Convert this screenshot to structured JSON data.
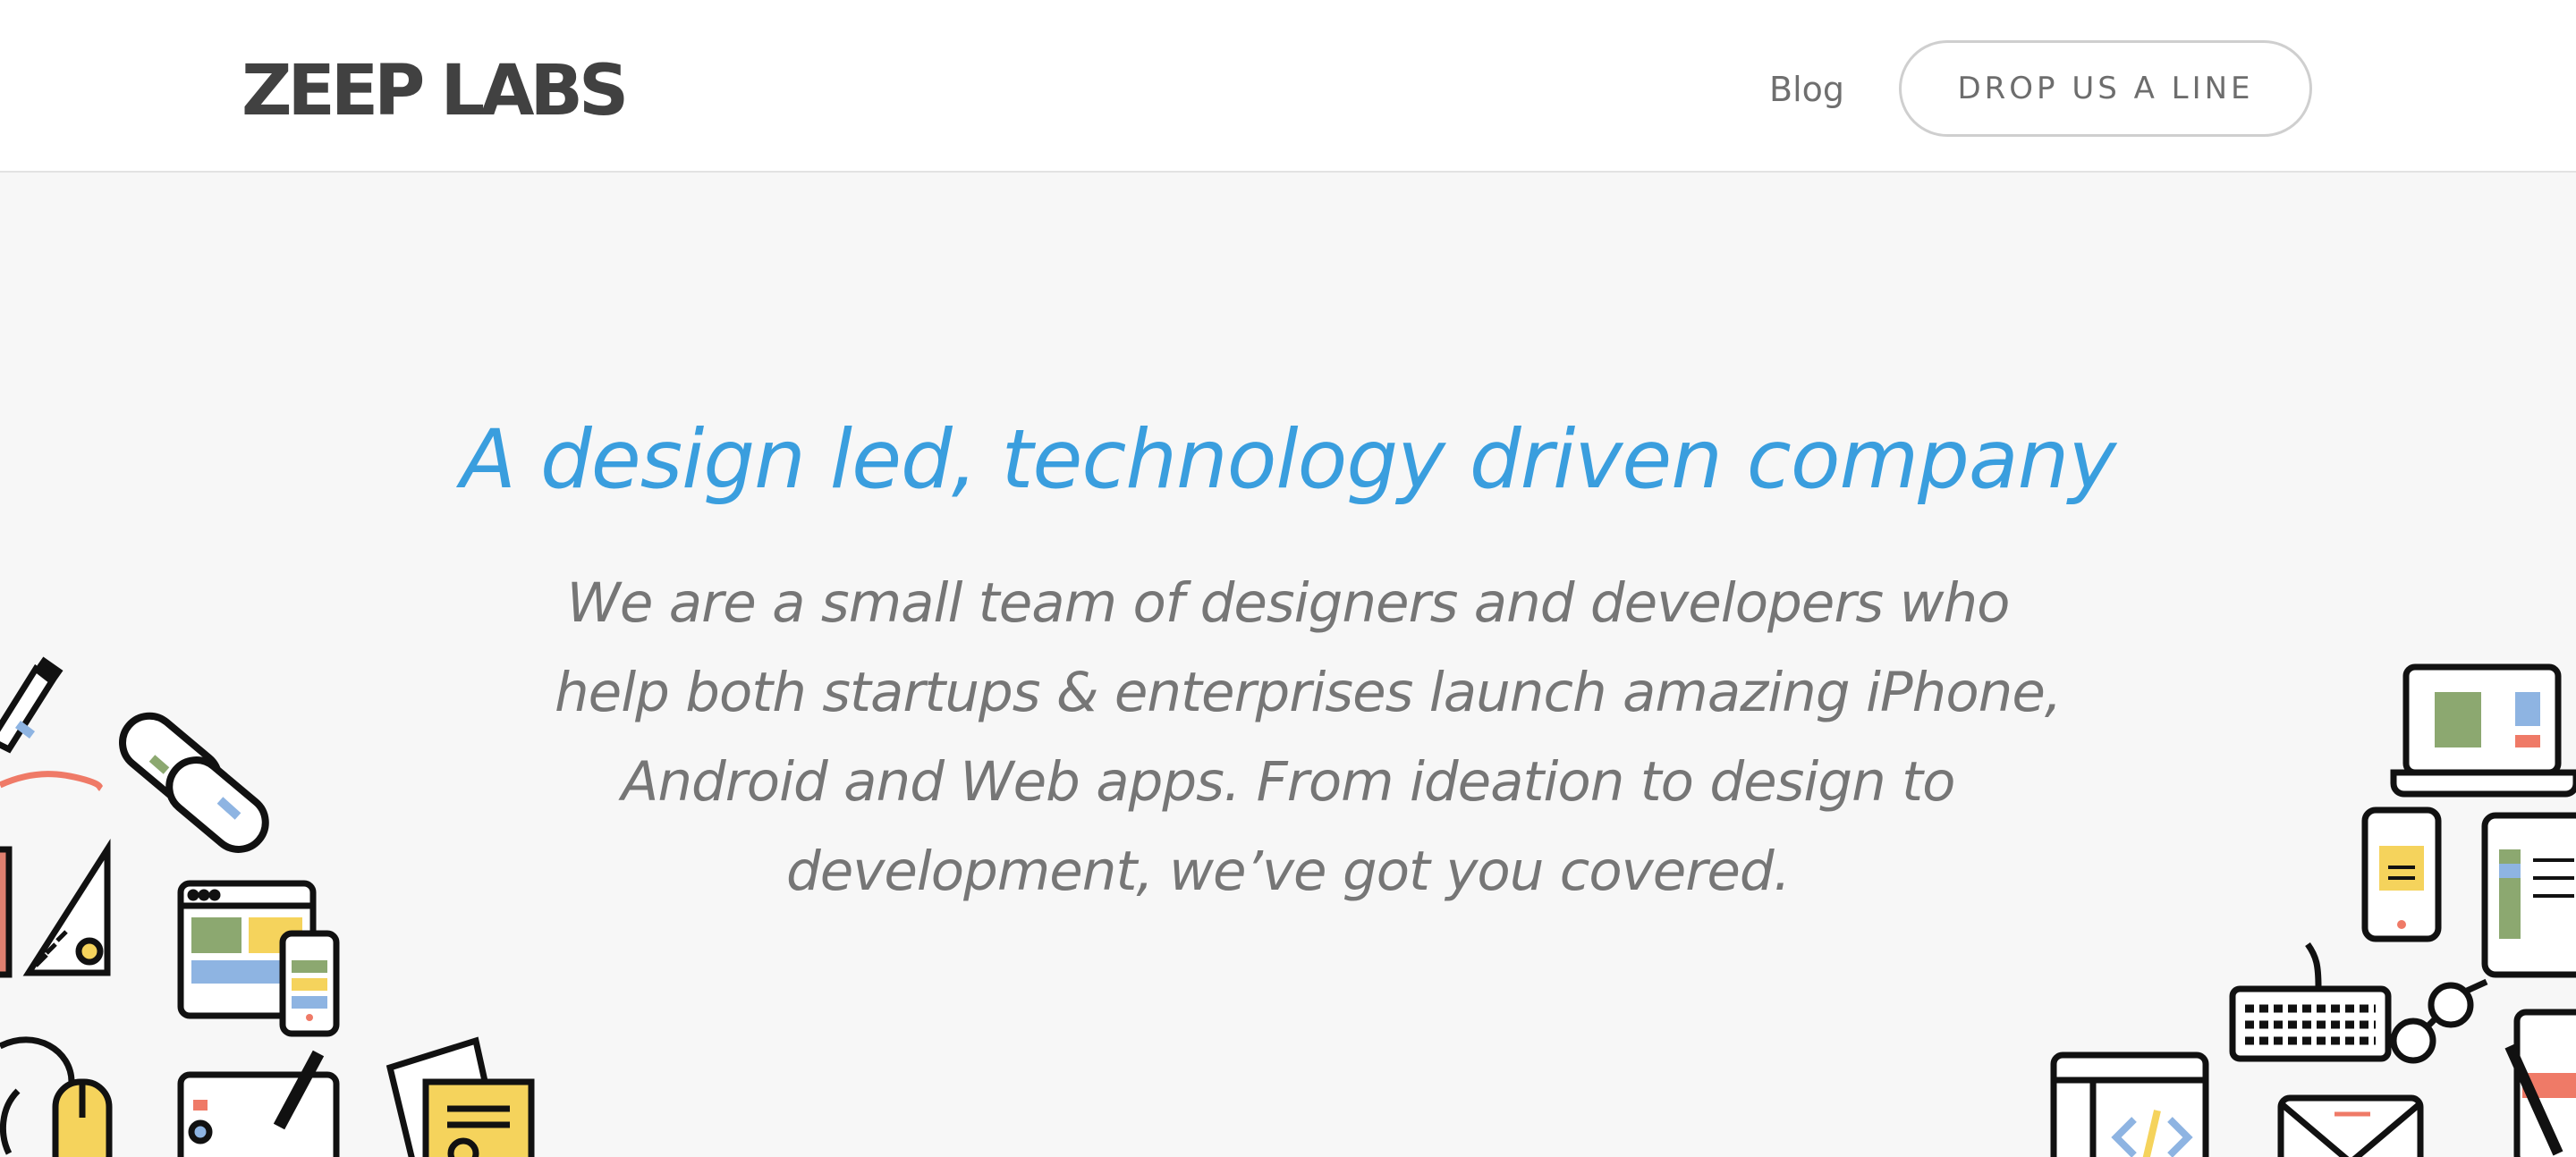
{
  "brand": {
    "logo_text": "ZEEP LABS"
  },
  "nav": {
    "blog_label": "Blog",
    "cta_label": "DROP US A LINE"
  },
  "hero": {
    "title": "A design led, technology driven company",
    "lines": [
      "We are a small team of designers and developers who",
      "help both startups & enterprises launch amazing iPhone,",
      "Android and Web apps. From ideation to design to",
      "development, we’ve got you covered."
    ]
  },
  "colors": {
    "accent": "#3a9ede",
    "logo": "#414141",
    "body_text": "#767676",
    "background": "#f7f7f7",
    "illustration_green": "#8ca870",
    "illustration_yellow": "#f5d35c",
    "illustration_blue": "#8eb4e2",
    "illustration_red": "#ef7a67"
  },
  "decorations": {
    "left": [
      "pencil-icon",
      "link-chain-icon",
      "ruler-triangle-icon",
      "browser-window-icon",
      "smartphone-icon",
      "mouse-icon",
      "tablet-pen-icon",
      "document-icon"
    ],
    "right": [
      "laptop-icon",
      "smartphone-icon",
      "tablet-icon",
      "keyboard-icon",
      "glasses-icon",
      "code-window-icon",
      "envelope-icon",
      "notebook-icon"
    ]
  }
}
